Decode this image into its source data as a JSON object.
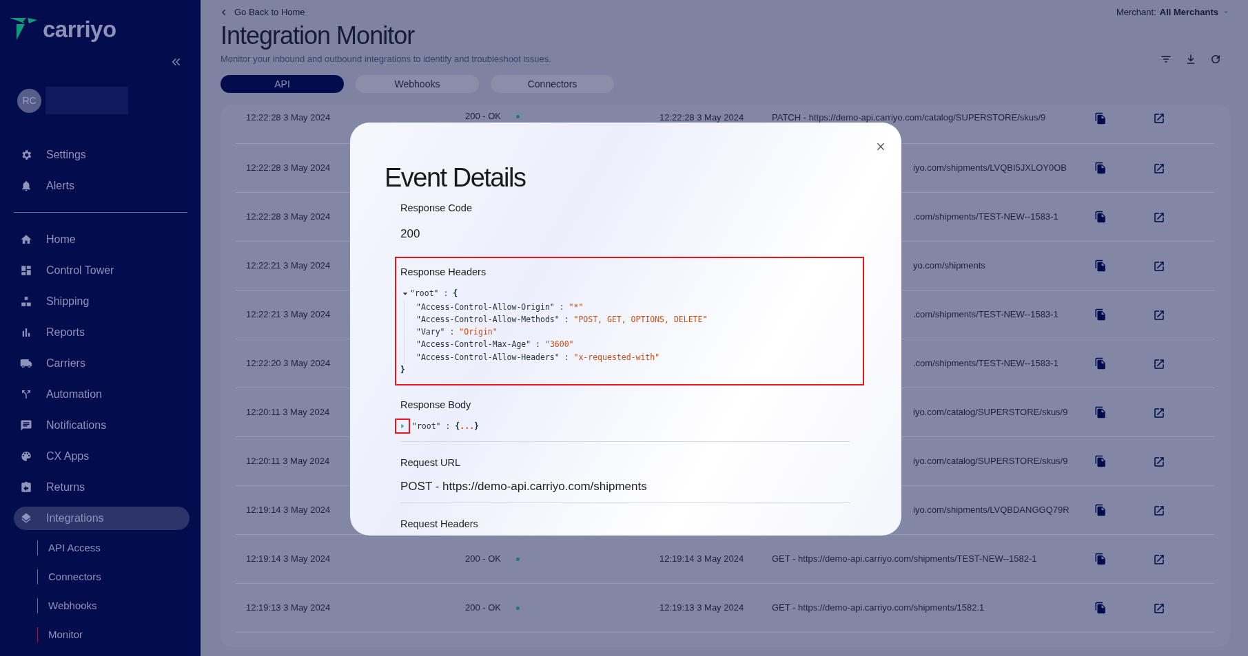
{
  "sidebar": {
    "logo": "carriyo",
    "avatar": "RC",
    "top_items": [
      {
        "label": "Settings"
      },
      {
        "label": "Alerts"
      }
    ],
    "nav_items": [
      {
        "label": "Home",
        "selected": false
      },
      {
        "label": "Control Tower",
        "selected": false
      },
      {
        "label": "Shipping",
        "selected": false
      },
      {
        "label": "Reports",
        "selected": false
      },
      {
        "label": "Carriers",
        "selected": false
      },
      {
        "label": "Automation",
        "selected": false
      },
      {
        "label": "Notifications",
        "selected": false
      },
      {
        "label": "CX Apps",
        "selected": false
      },
      {
        "label": "Returns",
        "selected": false
      },
      {
        "label": "Integrations",
        "selected": true
      }
    ],
    "sub_items": [
      {
        "label": "API Access",
        "selected": false
      },
      {
        "label": "Connectors",
        "selected": false
      },
      {
        "label": "Webhooks",
        "selected": false
      },
      {
        "label": "Monitor",
        "selected": true
      }
    ]
  },
  "header": {
    "back_link": "Go Back to Home",
    "title": "Integration Monitor",
    "subtitle": "Monitor your inbound and outbound integrations to identify and troubleshoot issues.",
    "merchant_label": "Merchant:",
    "merchant_value": "All Merchants"
  },
  "tabs": [
    {
      "label": "API",
      "selected": true
    },
    {
      "label": "Webhooks",
      "selected": false
    },
    {
      "label": "Connectors",
      "selected": false
    }
  ],
  "table": {
    "rows": [
      {
        "time": "12:22:28 3 May 2024",
        "status": "200 - OK",
        "color": "#12806a",
        "time2": "12:22:28 3 May 2024",
        "url": "PATCH - https://demo-api.carriyo.com/catalog/SUPERSTORE/skus/9",
        "url_clipped": false
      },
      {
        "time": "12:22:28 3 May 2024",
        "url": "iyo.com/shipments/LVQBI5JXLOY0OB",
        "url_clipped": true
      },
      {
        "time": "12:22:28 3 May 2024",
        "url": ".com/shipments/TEST-NEW--1583-1",
        "url_clipped": true
      },
      {
        "time": "12:22:21 3 May 2024",
        "url": "yo.com/shipments",
        "url_clipped": true
      },
      {
        "time": "12:22:21 3 May 2024",
        "url": ".com/shipments/TEST-NEW--1583-1",
        "url_clipped": true
      },
      {
        "time": "12:22:20 3 May 2024",
        "url": ".com/shipments/TEST-NEW--1583-1",
        "url_clipped": true
      },
      {
        "time": "12:20:11 3 May 2024",
        "url": "iyo.com/catalog/SUPERSTORE/skus/9",
        "url_clipped": true
      },
      {
        "time": "12:20:11 3 May 2024",
        "url": "iyo.com/catalog/SUPERSTORE/skus/9",
        "url_clipped": true
      },
      {
        "time": "12:19:14 3 May 2024",
        "url": "iyo.com/shipments/LVQBDANGGQ79R",
        "url_clipped": true
      },
      {
        "time": "12:19:14 3 May 2024",
        "status": "200 - OK",
        "color": "#12806a",
        "time2": "12:19:14 3 May 2024",
        "url": "GET - https://demo-api.carriyo.com/shipments/TEST-NEW--1582-1",
        "url_clipped": false
      },
      {
        "time": "12:19:13 3 May 2024",
        "status": "200 - OK",
        "color": "#12806a",
        "time2": "12:19:13 3 May 2024",
        "url": "GET - https://demo-api.carriyo.com/shipments/1582.1",
        "url_clipped": false
      }
    ]
  },
  "modal": {
    "title": "Event Details",
    "response_code": {
      "label": "Response Code",
      "value": "200"
    },
    "response_headers": {
      "label": "Response Headers",
      "highlighted": true,
      "tree": {
        "key": "\"root\"",
        "separator": ":",
        "expanded": true,
        "open": "{",
        "close": "}",
        "entries": [
          {
            "key": "\"Access-Control-Allow-Origin\"",
            "value": "\"*\""
          },
          {
            "key": "\"Access-Control-Allow-Methods\"",
            "value": "\"POST, GET, OPTIONS, DELETE\""
          },
          {
            "key": "\"Vary\"",
            "value": "\"Origin\""
          },
          {
            "key": "\"Access-Control-Max-Age\"",
            "value": "\"3600\""
          },
          {
            "key": "\"Access-Control-Allow-Headers\"",
            "value": "\"x-requested-with\""
          }
        ]
      }
    },
    "response_body": {
      "label": "Response Body",
      "toggle_highlighted": true,
      "tree": {
        "key": "\"root\"",
        "separator": ":",
        "expanded": false,
        "preview": "{...}"
      }
    },
    "request_url": {
      "label": "Request URL",
      "value": "POST - https://demo-api.carriyo.com/shipments"
    },
    "request_headers": {
      "label": "Request Headers"
    }
  }
}
